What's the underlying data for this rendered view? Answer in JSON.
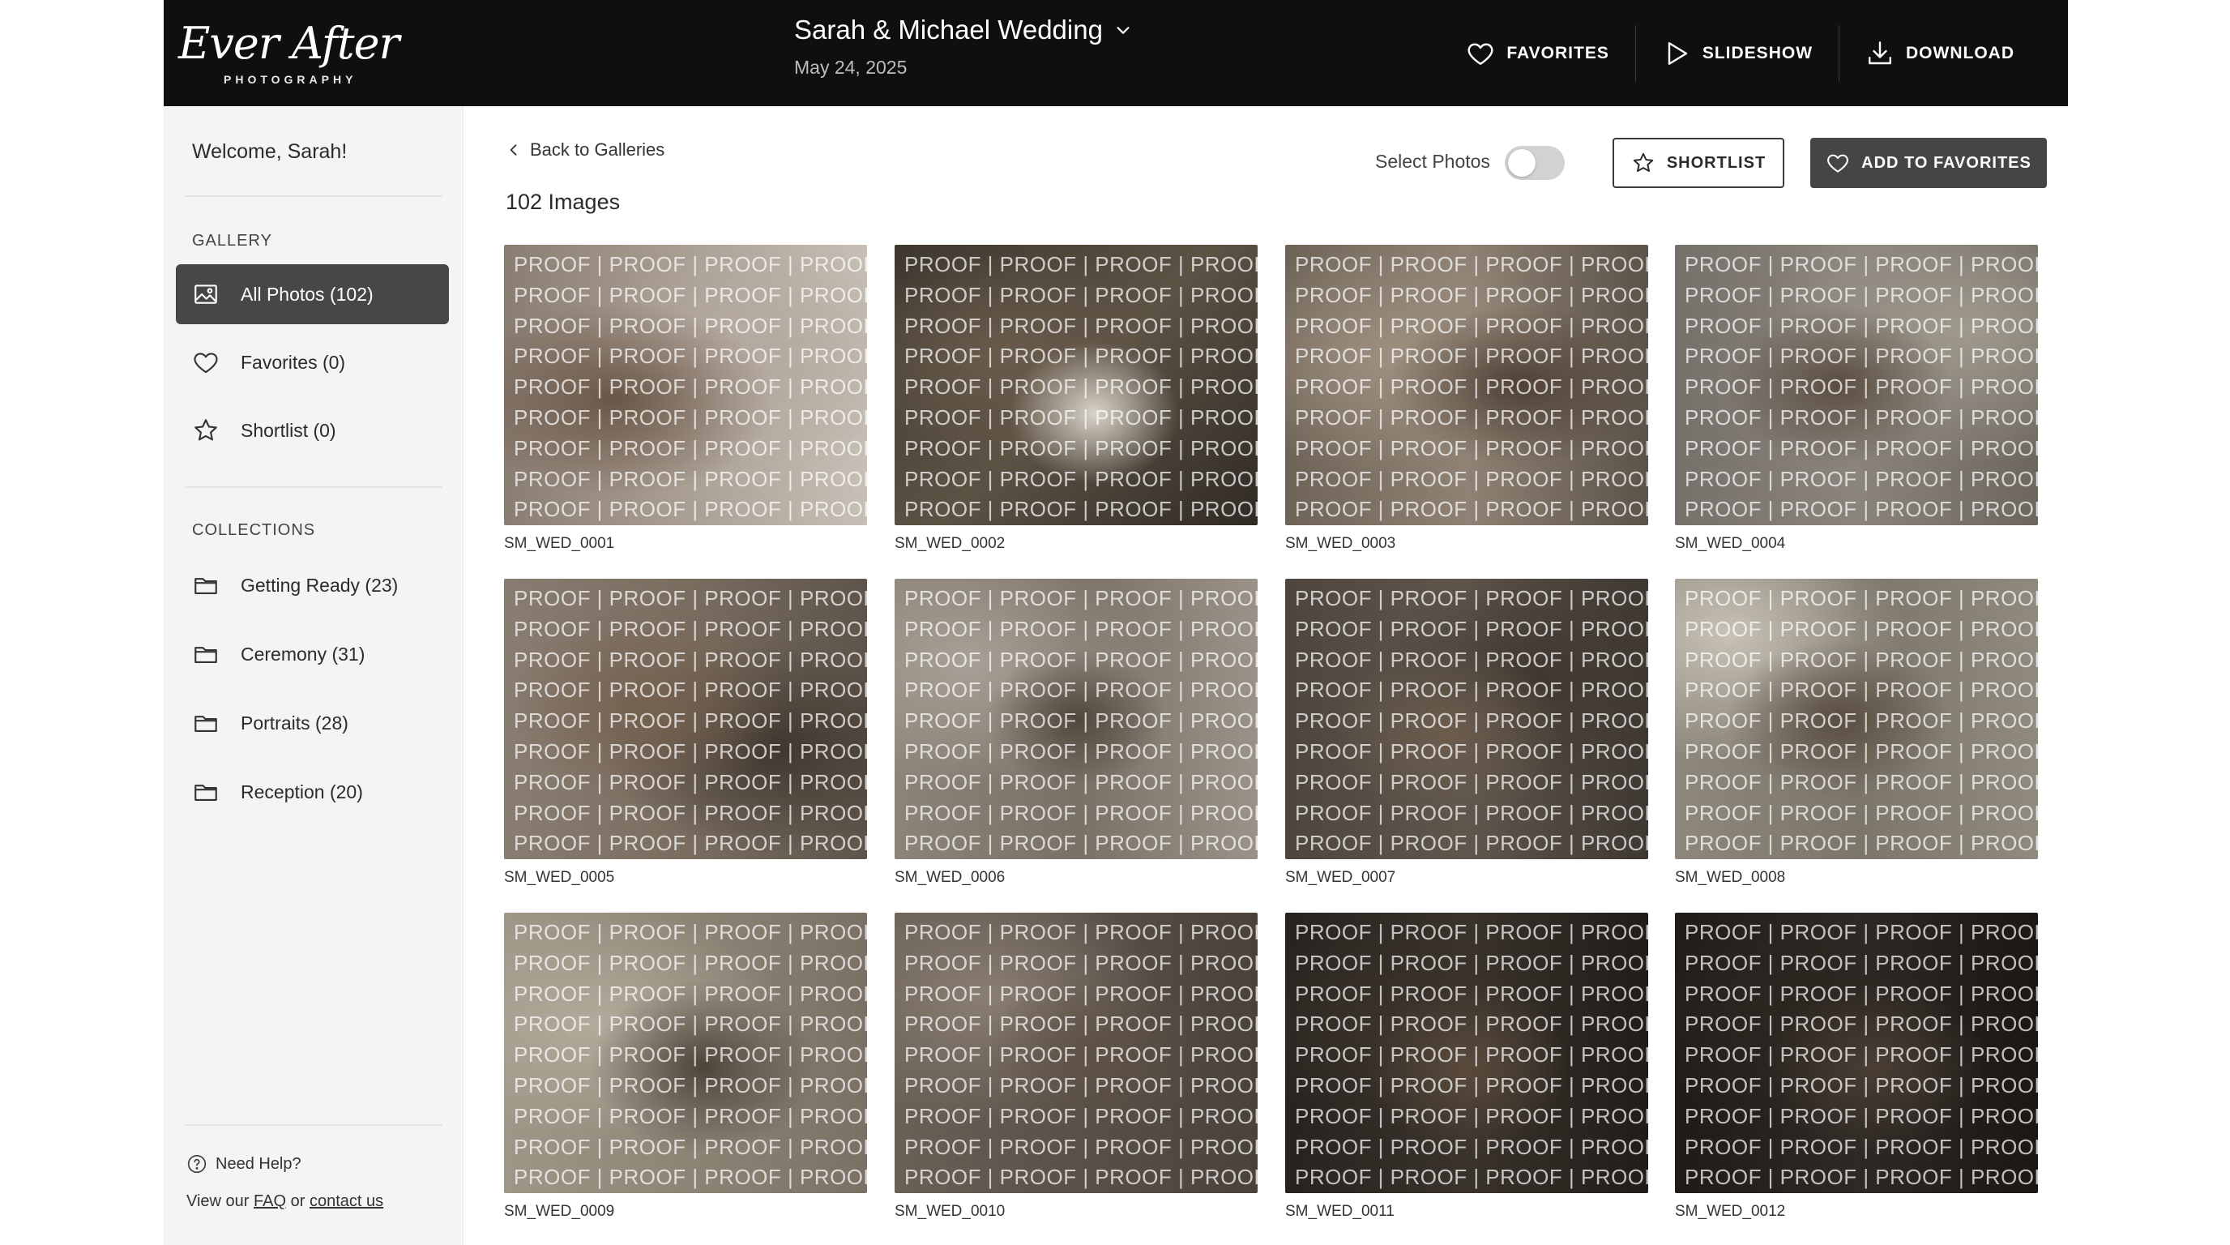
{
  "brand": {
    "script": "Ever After",
    "sub": "PHOTOGRAPHY"
  },
  "header": {
    "title": "Sarah & Michael Wedding",
    "date": "May 24, 2025",
    "actions": {
      "favorites": "FAVORITES",
      "slideshow": "SLIDESHOW",
      "download": "DOWNLOAD"
    }
  },
  "sidebar": {
    "welcome": "Welcome, Sarah!",
    "gallery_title": "GALLERY",
    "gallery_items": [
      {
        "label": "All Photos (102)",
        "icon": "image-icon",
        "active": true
      },
      {
        "label": "Favorites (0)",
        "icon": "heart-icon",
        "active": false
      },
      {
        "label": "Shortlist (0)",
        "icon": "star-icon",
        "active": false
      }
    ],
    "collections_title": "COLLECTIONS",
    "collections": [
      {
        "label": "Getting Ready (23)",
        "icon": "folder-icon"
      },
      {
        "label": "Ceremony (31)",
        "icon": "folder-icon"
      },
      {
        "label": "Portraits (28)",
        "icon": "folder-icon"
      },
      {
        "label": "Reception (20)",
        "icon": "folder-icon"
      }
    ],
    "help": {
      "title": "Need Help?",
      "prefix": "View our",
      "faq": "FAQ",
      "or": "or",
      "contact": "contact us"
    }
  },
  "main": {
    "back": "Back to Galleries",
    "count": "102 Images",
    "select_label": "Select Photos",
    "select_on": false,
    "shortlist_btn": "SHORTLIST",
    "favorites_btn": "ADD TO FAVORITES",
    "watermark": "PROOF | PROOF | PROOF | PROOF",
    "photos": [
      "SM_WED_0001",
      "SM_WED_0002",
      "SM_WED_0003",
      "SM_WED_0004",
      "SM_WED_0005",
      "SM_WED_0006",
      "SM_WED_0007",
      "SM_WED_0008",
      "SM_WED_0009",
      "SM_WED_0010",
      "SM_WED_0011",
      "SM_WED_0012"
    ]
  },
  "colors": {
    "header_bg": "#0f0f0f",
    "sidebar_bg": "#f4f4f4",
    "active_nav": "#474747",
    "primary_button": "#454545"
  }
}
